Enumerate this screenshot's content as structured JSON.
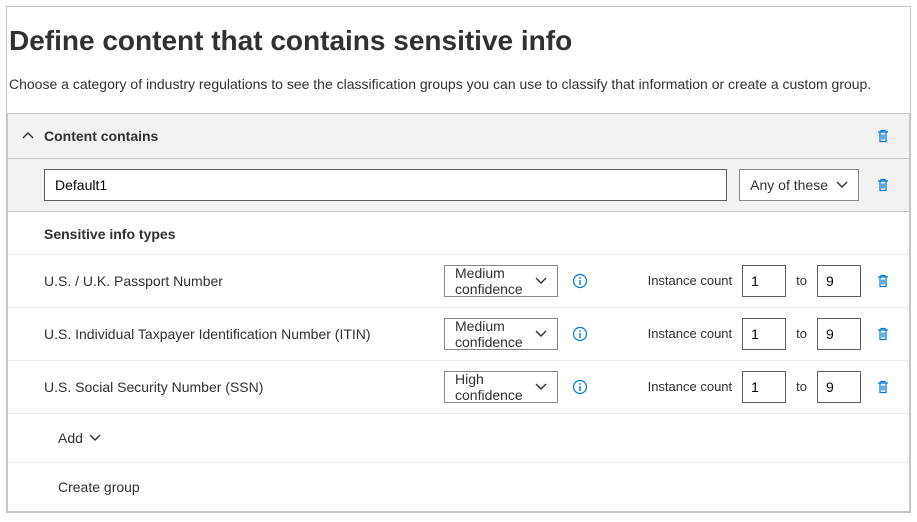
{
  "header": {
    "title": "Define content that contains sensitive info",
    "intro": "Choose a category of industry regulations to see the classification groups you can use to classify that information or create a custom group."
  },
  "panel": {
    "title": "Content contains",
    "group_name": "Default1",
    "match_mode": "Any of these",
    "subheader": "Sensitive info types",
    "instance_count_label": "Instance count",
    "to_label": "to",
    "rows": [
      {
        "label": "U.S. / U.K. Passport Number",
        "confidence": "Medium confidence",
        "min": "1",
        "max": "9"
      },
      {
        "label": "U.S. Individual Taxpayer Identification Number (ITIN)",
        "confidence": "Medium confidence",
        "min": "1",
        "max": "9"
      },
      {
        "label": "U.S. Social Security Number (SSN)",
        "confidence": "High confidence",
        "min": "1",
        "max": "9"
      }
    ],
    "add_label": "Add",
    "create_group_label": "Create group"
  }
}
